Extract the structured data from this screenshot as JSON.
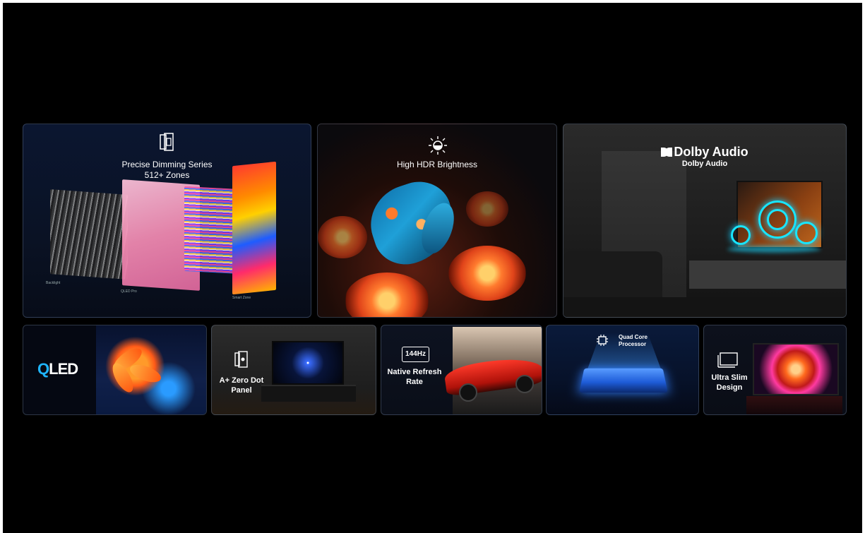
{
  "tiles": {
    "dimming": {
      "line1": "Precise Dimming Series",
      "line2": "512+ Zones",
      "icon": "layers-icon",
      "captions": [
        "Backlight",
        "QLED Pro",
        "Smart Zone"
      ]
    },
    "hdr": {
      "label": "High HDR Brightness",
      "icon": "sun-icon"
    },
    "dolby": {
      "brand": "Dolby Audio",
      "sub": "Dolby Audio",
      "icon": "dolby-icon"
    },
    "qled": {
      "brand": "QLED"
    },
    "zero_dot": {
      "line1": "A+ Zero Dot",
      "line2": "Panel",
      "icon": "panel-icon"
    },
    "refresh": {
      "badge": "144Hz",
      "line1": "Native Refresh",
      "line2": "Rate"
    },
    "processor": {
      "line1": "Quad Core",
      "line2": "Processor",
      "icon": "cpu-icon"
    },
    "slim": {
      "line1": "Ultra Slim",
      "line2": "Design",
      "icon": "slim-tv-icon"
    }
  },
  "colors": {
    "background": "#000000",
    "qled_accent": "#1fb5ff",
    "dolby_ring": "#19e6ff"
  }
}
